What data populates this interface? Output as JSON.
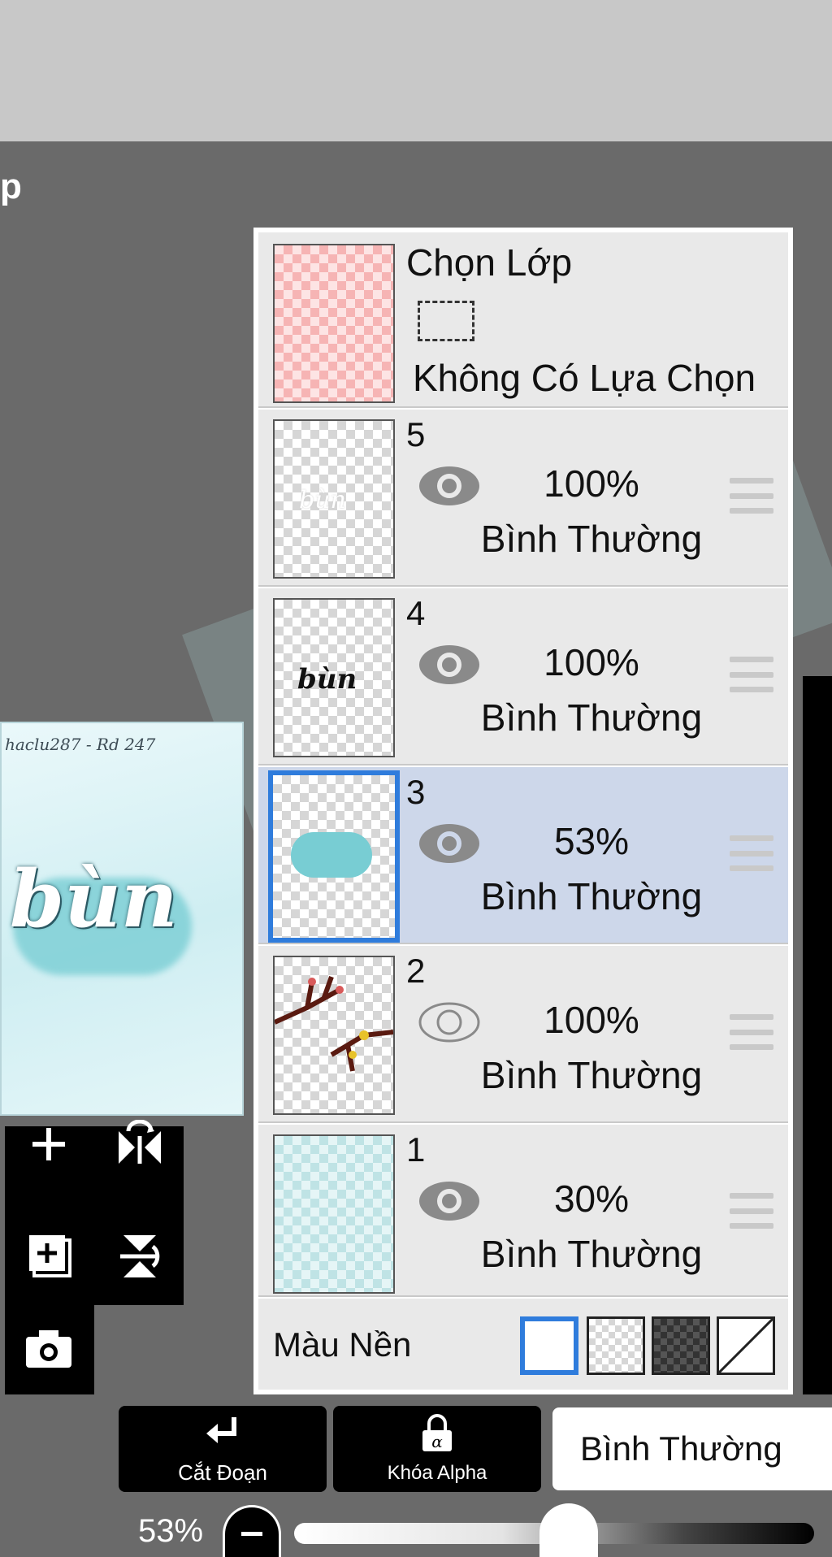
{
  "app": {
    "title_fragment": "p"
  },
  "preview": {
    "watermark": "haclu287 - Rd 247",
    "word": "bùn"
  },
  "layers_panel": {
    "selection_layer": {
      "title": "Chọn Lớp",
      "status": "Không Có Lựa Chọn"
    },
    "layers": [
      {
        "number": "5",
        "opacity": "100%",
        "blend": "Bình Thường",
        "visible": true,
        "thumb_text": "bùn"
      },
      {
        "number": "4",
        "opacity": "100%",
        "blend": "Bình Thường",
        "visible": true,
        "thumb_text": "bùn"
      },
      {
        "number": "3",
        "opacity": "53%",
        "blend": "Bình Thường",
        "visible": true,
        "thumb_text": "",
        "selected": true
      },
      {
        "number": "2",
        "opacity": "100%",
        "blend": "Bình Thường",
        "visible": false,
        "thumb_text": ""
      },
      {
        "number": "1",
        "opacity": "30%",
        "blend": "Bình Thường",
        "visible": true,
        "thumb_text": ""
      }
    ],
    "background": {
      "label": "Màu Nền",
      "options": [
        "white",
        "checker-light",
        "checker-dark",
        "none"
      ],
      "selected": "white"
    }
  },
  "bottom_bar": {
    "clip_label": "Cắt Đoạn",
    "alpha_lock_label": "Khóa Alpha",
    "blend_mode": "Bình Thường",
    "opacity_value": "53%",
    "opacity_fraction": 0.53
  },
  "colors": {
    "selected_row": "#cdd7ea",
    "selection_accent": "#2f7cdc"
  }
}
